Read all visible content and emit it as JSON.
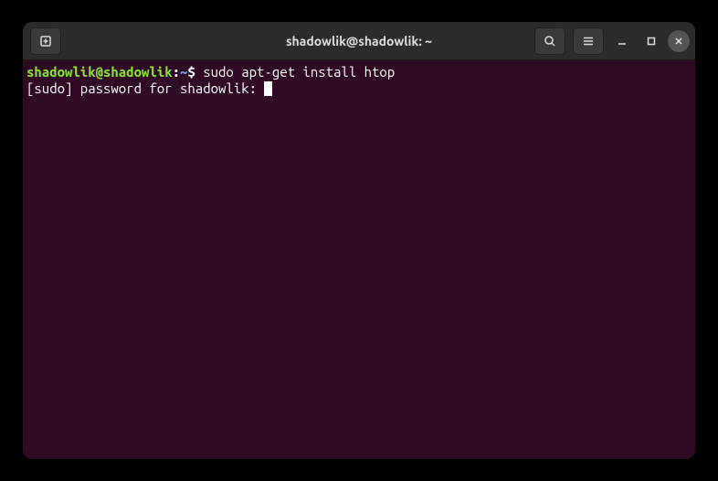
{
  "window": {
    "title": "shadowlik@shadowlik: ~"
  },
  "terminal": {
    "prompt_user_host": "shadowlik@shadowlik",
    "prompt_colon": ":",
    "prompt_path": "~",
    "prompt_dollar": "$ ",
    "command": "sudo apt-get install htop",
    "output_line": "[sudo] password for shadowlik: "
  }
}
